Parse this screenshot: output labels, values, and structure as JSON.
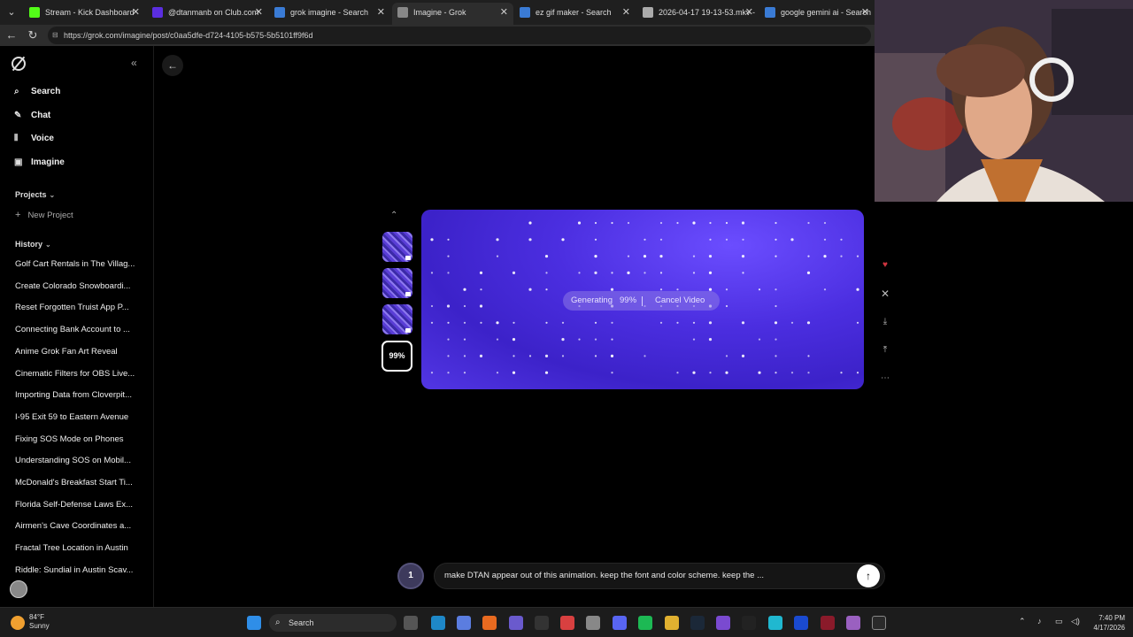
{
  "browser": {
    "tabs": [
      {
        "label": "Stream - Kick Dashboard",
        "icon": "kick-icon",
        "color": "#53fc18"
      },
      {
        "label": "@dtanmanb on Club.com",
        "icon": "club-icon",
        "color": "#5b2ee0"
      },
      {
        "label": "grok imagine - Search",
        "icon": "search-icon",
        "color": "#3a7bd5"
      },
      {
        "label": "Imagine - Grok",
        "icon": "grok-icon",
        "color": "#888888"
      },
      {
        "label": "ez gif maker - Search",
        "icon": "search-icon",
        "color": "#3a7bd5"
      },
      {
        "label": "2026-04-17 19-13-53.mkv -",
        "icon": "video-icon",
        "color": "#aaaaaa"
      },
      {
        "label": "google gemini ai - Search",
        "icon": "search-icon",
        "color": "#3a7bd5"
      }
    ],
    "url": "https://grok.com/imagine/post/c0aa5dfe-d724-4105-b575-5b5101ff9f6d"
  },
  "sidebar": {
    "nav": [
      {
        "label": "Search",
        "icon": "search-icon"
      },
      {
        "label": "Chat",
        "icon": "chat-icon"
      },
      {
        "label": "Voice",
        "icon": "voice-icon"
      },
      {
        "label": "Imagine",
        "icon": "image-icon"
      }
    ],
    "projects_label": "Projects",
    "new_project_label": "New Project",
    "history_label": "History",
    "history": [
      "Golf Cart Rentals in The Villag...",
      "Create Colorado Snowboardi...",
      "Reset Forgotten Truist App P...",
      "Connecting Bank Account to ...",
      "Anime Grok Fan Art Reveal",
      "Cinematic Filters for OBS Live...",
      "Importing Data from Cloverpit...",
      "I-95 Exit 59 to Eastern Avenue",
      "Fixing SOS Mode on Phones",
      "Understanding SOS on Mobil...",
      "McDonald's Breakfast Start Ti...",
      "Florida Self-Defense Laws Ex...",
      "Airmen's Cave Coordinates a...",
      "Fractal Tree Location in Austin",
      "Riddle: Sundial in Austin Scav..."
    ]
  },
  "main": {
    "active_thumb_label": "99%",
    "generating_label": "Generating",
    "generating_percent": "99%",
    "progress": 0.99,
    "cancel_label": "Cancel Video",
    "prompt_text": "make DTAN appear out of this animation. keep the font and color scheme. keep the ...",
    "prompt_count": "1",
    "accent_color": "#4b2ee0"
  },
  "taskbar": {
    "weather_temp": "84°F",
    "weather_desc": "Sunny",
    "search_label": "Search",
    "time": "7:40 PM",
    "date": "4/17/2026"
  }
}
